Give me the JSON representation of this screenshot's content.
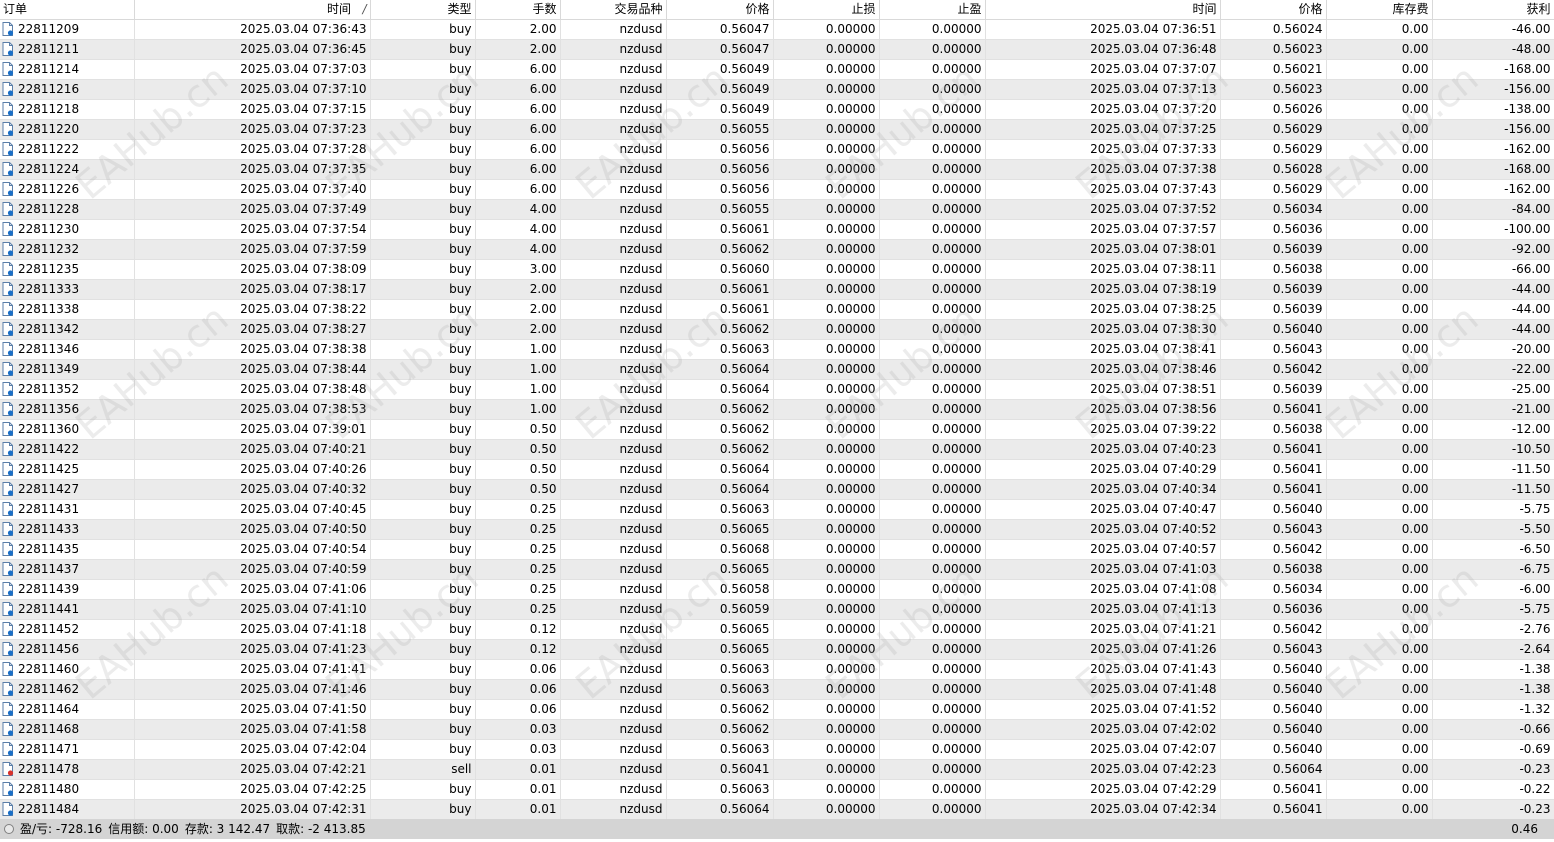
{
  "columns": [
    "订单",
    "时间",
    "类型",
    "手数",
    "交易品种",
    "价格",
    "止损",
    "止盈",
    "时间",
    "价格",
    "库存费",
    "获利"
  ],
  "sort_indicator": "/",
  "rows": [
    [
      "22811209",
      "2025.03.04 07:36:43",
      "buy",
      "2.00",
      "nzdusd",
      "0.56047",
      "0.00000",
      "0.00000",
      "2025.03.04 07:36:51",
      "0.56024",
      "0.00",
      "-46.00"
    ],
    [
      "22811211",
      "2025.03.04 07:36:45",
      "buy",
      "2.00",
      "nzdusd",
      "0.56047",
      "0.00000",
      "0.00000",
      "2025.03.04 07:36:48",
      "0.56023",
      "0.00",
      "-48.00"
    ],
    [
      "22811214",
      "2025.03.04 07:37:03",
      "buy",
      "6.00",
      "nzdusd",
      "0.56049",
      "0.00000",
      "0.00000",
      "2025.03.04 07:37:07",
      "0.56021",
      "0.00",
      "-168.00"
    ],
    [
      "22811216",
      "2025.03.04 07:37:10",
      "buy",
      "6.00",
      "nzdusd",
      "0.56049",
      "0.00000",
      "0.00000",
      "2025.03.04 07:37:13",
      "0.56023",
      "0.00",
      "-156.00"
    ],
    [
      "22811218",
      "2025.03.04 07:37:15",
      "buy",
      "6.00",
      "nzdusd",
      "0.56049",
      "0.00000",
      "0.00000",
      "2025.03.04 07:37:20",
      "0.56026",
      "0.00",
      "-138.00"
    ],
    [
      "22811220",
      "2025.03.04 07:37:23",
      "buy",
      "6.00",
      "nzdusd",
      "0.56055",
      "0.00000",
      "0.00000",
      "2025.03.04 07:37:25",
      "0.56029",
      "0.00",
      "-156.00"
    ],
    [
      "22811222",
      "2025.03.04 07:37:28",
      "buy",
      "6.00",
      "nzdusd",
      "0.56056",
      "0.00000",
      "0.00000",
      "2025.03.04 07:37:33",
      "0.56029",
      "0.00",
      "-162.00"
    ],
    [
      "22811224",
      "2025.03.04 07:37:35",
      "buy",
      "6.00",
      "nzdusd",
      "0.56056",
      "0.00000",
      "0.00000",
      "2025.03.04 07:37:38",
      "0.56028",
      "0.00",
      "-168.00"
    ],
    [
      "22811226",
      "2025.03.04 07:37:40",
      "buy",
      "6.00",
      "nzdusd",
      "0.56056",
      "0.00000",
      "0.00000",
      "2025.03.04 07:37:43",
      "0.56029",
      "0.00",
      "-162.00"
    ],
    [
      "22811228",
      "2025.03.04 07:37:49",
      "buy",
      "4.00",
      "nzdusd",
      "0.56055",
      "0.00000",
      "0.00000",
      "2025.03.04 07:37:52",
      "0.56034",
      "0.00",
      "-84.00"
    ],
    [
      "22811230",
      "2025.03.04 07:37:54",
      "buy",
      "4.00",
      "nzdusd",
      "0.56061",
      "0.00000",
      "0.00000",
      "2025.03.04 07:37:57",
      "0.56036",
      "0.00",
      "-100.00"
    ],
    [
      "22811232",
      "2025.03.04 07:37:59",
      "buy",
      "4.00",
      "nzdusd",
      "0.56062",
      "0.00000",
      "0.00000",
      "2025.03.04 07:38:01",
      "0.56039",
      "0.00",
      "-92.00"
    ],
    [
      "22811235",
      "2025.03.04 07:38:09",
      "buy",
      "3.00",
      "nzdusd",
      "0.56060",
      "0.00000",
      "0.00000",
      "2025.03.04 07:38:11",
      "0.56038",
      "0.00",
      "-66.00"
    ],
    [
      "22811333",
      "2025.03.04 07:38:17",
      "buy",
      "2.00",
      "nzdusd",
      "0.56061",
      "0.00000",
      "0.00000",
      "2025.03.04 07:38:19",
      "0.56039",
      "0.00",
      "-44.00"
    ],
    [
      "22811338",
      "2025.03.04 07:38:22",
      "buy",
      "2.00",
      "nzdusd",
      "0.56061",
      "0.00000",
      "0.00000",
      "2025.03.04 07:38:25",
      "0.56039",
      "0.00",
      "-44.00"
    ],
    [
      "22811342",
      "2025.03.04 07:38:27",
      "buy",
      "2.00",
      "nzdusd",
      "0.56062",
      "0.00000",
      "0.00000",
      "2025.03.04 07:38:30",
      "0.56040",
      "0.00",
      "-44.00"
    ],
    [
      "22811346",
      "2025.03.04 07:38:38",
      "buy",
      "1.00",
      "nzdusd",
      "0.56063",
      "0.00000",
      "0.00000",
      "2025.03.04 07:38:41",
      "0.56043",
      "0.00",
      "-20.00"
    ],
    [
      "22811349",
      "2025.03.04 07:38:44",
      "buy",
      "1.00",
      "nzdusd",
      "0.56064",
      "0.00000",
      "0.00000",
      "2025.03.04 07:38:46",
      "0.56042",
      "0.00",
      "-22.00"
    ],
    [
      "22811352",
      "2025.03.04 07:38:48",
      "buy",
      "1.00",
      "nzdusd",
      "0.56064",
      "0.00000",
      "0.00000",
      "2025.03.04 07:38:51",
      "0.56039",
      "0.00",
      "-25.00"
    ],
    [
      "22811356",
      "2025.03.04 07:38:53",
      "buy",
      "1.00",
      "nzdusd",
      "0.56062",
      "0.00000",
      "0.00000",
      "2025.03.04 07:38:56",
      "0.56041",
      "0.00",
      "-21.00"
    ],
    [
      "22811360",
      "2025.03.04 07:39:01",
      "buy",
      "0.50",
      "nzdusd",
      "0.56062",
      "0.00000",
      "0.00000",
      "2025.03.04 07:39:22",
      "0.56038",
      "0.00",
      "-12.00"
    ],
    [
      "22811422",
      "2025.03.04 07:40:21",
      "buy",
      "0.50",
      "nzdusd",
      "0.56062",
      "0.00000",
      "0.00000",
      "2025.03.04 07:40:23",
      "0.56041",
      "0.00",
      "-10.50"
    ],
    [
      "22811425",
      "2025.03.04 07:40:26",
      "buy",
      "0.50",
      "nzdusd",
      "0.56064",
      "0.00000",
      "0.00000",
      "2025.03.04 07:40:29",
      "0.56041",
      "0.00",
      "-11.50"
    ],
    [
      "22811427",
      "2025.03.04 07:40:32",
      "buy",
      "0.50",
      "nzdusd",
      "0.56064",
      "0.00000",
      "0.00000",
      "2025.03.04 07:40:34",
      "0.56041",
      "0.00",
      "-11.50"
    ],
    [
      "22811431",
      "2025.03.04 07:40:45",
      "buy",
      "0.25",
      "nzdusd",
      "0.56063",
      "0.00000",
      "0.00000",
      "2025.03.04 07:40:47",
      "0.56040",
      "0.00",
      "-5.75"
    ],
    [
      "22811433",
      "2025.03.04 07:40:50",
      "buy",
      "0.25",
      "nzdusd",
      "0.56065",
      "0.00000",
      "0.00000",
      "2025.03.04 07:40:52",
      "0.56043",
      "0.00",
      "-5.50"
    ],
    [
      "22811435",
      "2025.03.04 07:40:54",
      "buy",
      "0.25",
      "nzdusd",
      "0.56068",
      "0.00000",
      "0.00000",
      "2025.03.04 07:40:57",
      "0.56042",
      "0.00",
      "-6.50"
    ],
    [
      "22811437",
      "2025.03.04 07:40:59",
      "buy",
      "0.25",
      "nzdusd",
      "0.56065",
      "0.00000",
      "0.00000",
      "2025.03.04 07:41:03",
      "0.56038",
      "0.00",
      "-6.75"
    ],
    [
      "22811439",
      "2025.03.04 07:41:06",
      "buy",
      "0.25",
      "nzdusd",
      "0.56058",
      "0.00000",
      "0.00000",
      "2025.03.04 07:41:08",
      "0.56034",
      "0.00",
      "-6.00"
    ],
    [
      "22811441",
      "2025.03.04 07:41:10",
      "buy",
      "0.25",
      "nzdusd",
      "0.56059",
      "0.00000",
      "0.00000",
      "2025.03.04 07:41:13",
      "0.56036",
      "0.00",
      "-5.75"
    ],
    [
      "22811452",
      "2025.03.04 07:41:18",
      "buy",
      "0.12",
      "nzdusd",
      "0.56065",
      "0.00000",
      "0.00000",
      "2025.03.04 07:41:21",
      "0.56042",
      "0.00",
      "-2.76"
    ],
    [
      "22811456",
      "2025.03.04 07:41:23",
      "buy",
      "0.12",
      "nzdusd",
      "0.56065",
      "0.00000",
      "0.00000",
      "2025.03.04 07:41:26",
      "0.56043",
      "0.00",
      "-2.64"
    ],
    [
      "22811460",
      "2025.03.04 07:41:41",
      "buy",
      "0.06",
      "nzdusd",
      "0.56063",
      "0.00000",
      "0.00000",
      "2025.03.04 07:41:43",
      "0.56040",
      "0.00",
      "-1.38"
    ],
    [
      "22811462",
      "2025.03.04 07:41:46",
      "buy",
      "0.06",
      "nzdusd",
      "0.56063",
      "0.00000",
      "0.00000",
      "2025.03.04 07:41:48",
      "0.56040",
      "0.00",
      "-1.38"
    ],
    [
      "22811464",
      "2025.03.04 07:41:50",
      "buy",
      "0.06",
      "nzdusd",
      "0.56062",
      "0.00000",
      "0.00000",
      "2025.03.04 07:41:52",
      "0.56040",
      "0.00",
      "-1.32"
    ],
    [
      "22811468",
      "2025.03.04 07:41:58",
      "buy",
      "0.03",
      "nzdusd",
      "0.56062",
      "0.00000",
      "0.00000",
      "2025.03.04 07:42:02",
      "0.56040",
      "0.00",
      "-0.66"
    ],
    [
      "22811471",
      "2025.03.04 07:42:04",
      "buy",
      "0.03",
      "nzdusd",
      "0.56063",
      "0.00000",
      "0.00000",
      "2025.03.04 07:42:07",
      "0.56040",
      "0.00",
      "-0.69"
    ],
    [
      "22811478",
      "2025.03.04 07:42:21",
      "sell",
      "0.01",
      "nzdusd",
      "0.56041",
      "0.00000",
      "0.00000",
      "2025.03.04 07:42:23",
      "0.56064",
      "0.00",
      "-0.23"
    ],
    [
      "22811480",
      "2025.03.04 07:42:25",
      "buy",
      "0.01",
      "nzdusd",
      "0.56063",
      "0.00000",
      "0.00000",
      "2025.03.04 07:42:29",
      "0.56041",
      "0.00",
      "-0.22"
    ],
    [
      "22811484",
      "2025.03.04 07:42:31",
      "buy",
      "0.01",
      "nzdusd",
      "0.56064",
      "0.00000",
      "0.00000",
      "2025.03.04 07:42:34",
      "0.56041",
      "0.00",
      "-0.23"
    ]
  ],
  "footer": {
    "profit": "盈/亏: -728.16",
    "credit": "信用额: 0.00",
    "deposit": "存款: 3 142.47",
    "withdrawal": "取款: -2 413.85",
    "total": "0.46"
  },
  "watermark": "EAHub.cn",
  "colors": {
    "buy_icon": "#1a6fc7",
    "sell_icon": "#d9312b",
    "alt_row": "#ebebeb",
    "footer_bg": "#d4d4d4"
  }
}
